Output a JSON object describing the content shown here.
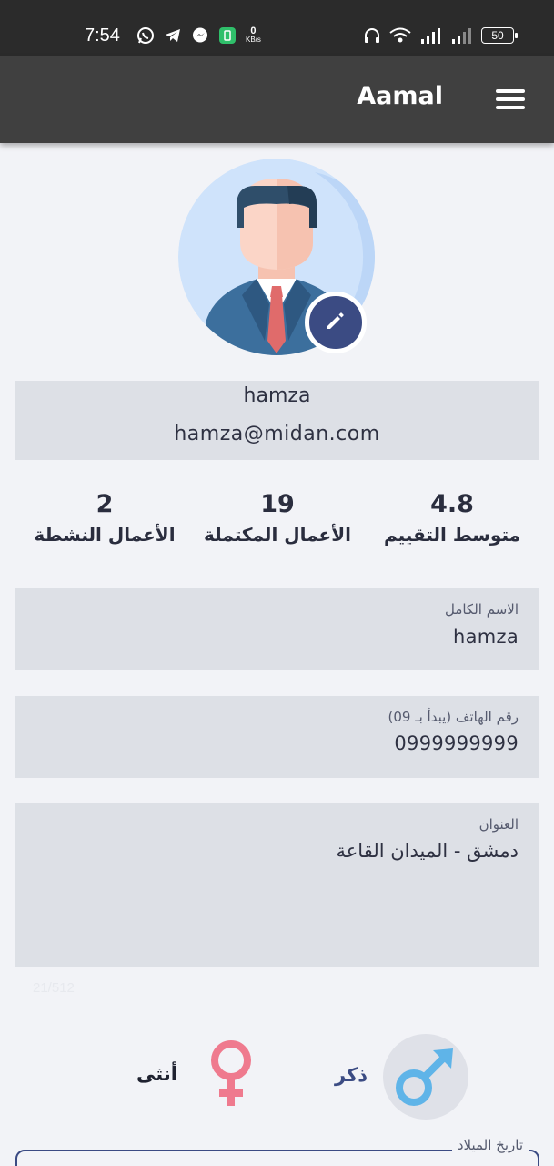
{
  "status_bar": {
    "time": "7:54",
    "net_speed_value": "0",
    "net_speed_unit": "KB/s",
    "battery": "50"
  },
  "app_bar": {
    "title": "Aamal"
  },
  "profile": {
    "name": "hamza",
    "email": "hamza@midan.com"
  },
  "stats": [
    {
      "value": "4.8",
      "label": "متوسط التقييم"
    },
    {
      "value": "19",
      "label": "الأعمال المكتملة"
    },
    {
      "value": "2",
      "label": "الأعمال النشطة"
    }
  ],
  "fields": {
    "full_name": {
      "label": "الاسم الكامل",
      "value": "hamza"
    },
    "phone": {
      "label": "رقم الهاتف (يبدأ بـ 09)",
      "value": "0999999999"
    },
    "address": {
      "label": "العنوان",
      "value": "دمشق - الميدان القاعة",
      "counter": "21/512"
    },
    "birth_date": {
      "label": "تاريخ الميلاد"
    }
  },
  "gender": {
    "male_label": "ذكر",
    "female_label": "أنثى"
  },
  "colors": {
    "app_bar": "#404040",
    "status_bar": "#2b2b2b",
    "accent": "#3b4b83",
    "field_background": "#dde0e6",
    "page_background": "#f2f3f7"
  }
}
